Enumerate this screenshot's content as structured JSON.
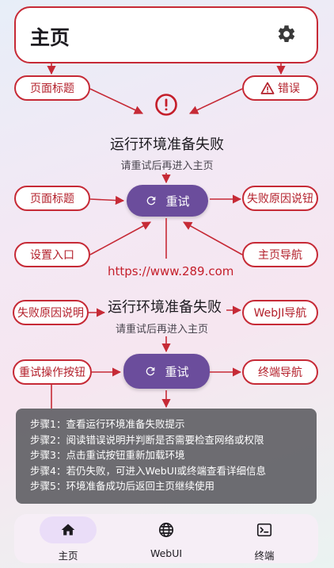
{
  "header": {
    "title": "主页",
    "settings_icon": "gear-icon"
  },
  "annotations": {
    "page_title_top": "页面标题",
    "error": "错误",
    "page_title_mid": "页面标题",
    "failure_reason_button": "失败原因说钮",
    "settings_entry": "设置入口",
    "home_navigation": "主页导航",
    "failure_reason_desc": "失败原因说明",
    "webui_navigation": "WebJI导航",
    "retry_action_button": "重试操作按钮",
    "terminal_navigation": "终端导航"
  },
  "error_block_1": {
    "title": "运行环境准备失败",
    "subtitle": "请重试后再进入主页",
    "retry_label": "重试"
  },
  "url": "https://www.289.com",
  "error_block_2": {
    "title": "运行环境准备失败",
    "subtitle": "请重试后再进入主页",
    "retry_label": "重试"
  },
  "steps": [
    "步骤1：查看运行环境准备失败提示",
    "步骤2：阅读错误说明并判断是否需要检查网络或权限",
    "步骤3：点击重试按钮重新加载环境",
    "步骤4：若仍失败，可进入WebUI或终端查看详细信息",
    "步骤5：环境准备成功后返回主页继续使用"
  ],
  "bottom_nav": [
    {
      "label": "主页",
      "icon": "home-icon",
      "active": true
    },
    {
      "label": "WebUI",
      "icon": "globe-icon",
      "active": false
    },
    {
      "label": "终端",
      "icon": "terminal-icon",
      "active": false
    }
  ],
  "colors": {
    "accent_red": "#c62a36",
    "retry_purple": "#6b4d9c",
    "nav_active": "#eaddf8"
  }
}
